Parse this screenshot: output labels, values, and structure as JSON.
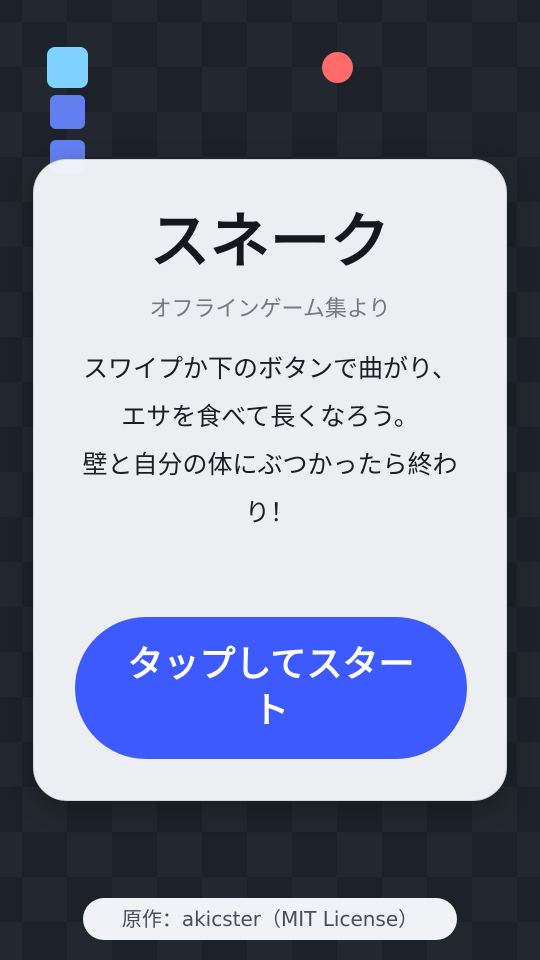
{
  "game": {
    "title": "スネーク",
    "subtitle": "オフラインゲーム集より",
    "description": "スワイプか下のボタンで曲がり、\nエサを食べて長くなろう。\n壁と自分の体にぶつかったら終わり！",
    "start_label": "タップしてスタート",
    "credit": "原作：akicster（MIT License）"
  },
  "colors": {
    "snake_head": "#7fd1ff",
    "snake_body": "#627ff0",
    "food": "#ff6b6b",
    "button": "#3d5afe",
    "card": "#f5f6f9"
  }
}
